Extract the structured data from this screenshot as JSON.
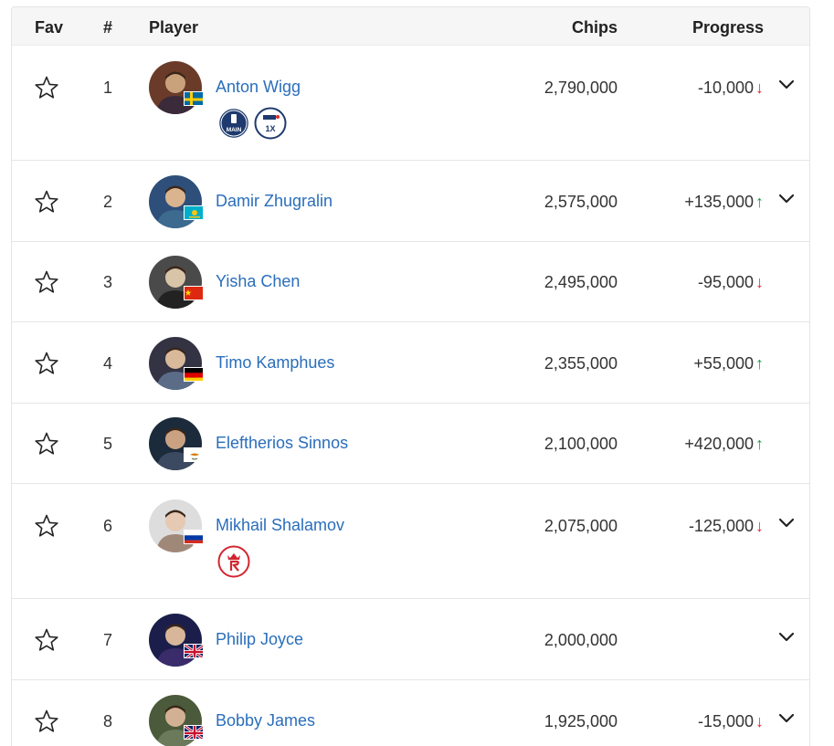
{
  "headers": {
    "fav": "Fav",
    "num": "#",
    "player": "Player",
    "chips": "Chips",
    "progress": "Progress"
  },
  "badge_text": {
    "main": "MAIN",
    "ept_count": "1X"
  },
  "colors": {
    "link": "#2a6ebb",
    "down": "#e02b2b",
    "up": "#1a9b3f",
    "header_bg": "#f6f6f6"
  },
  "rows": [
    {
      "rank": "1",
      "name": "Anton Wigg",
      "chips": "2,790,000",
      "progress": "-10,000",
      "dir": "down",
      "flag": "sweden-flag",
      "badges": [
        "main-event-badge",
        "ept-1x-badge"
      ],
      "expandable": true
    },
    {
      "rank": "2",
      "name": "Damir Zhugralin",
      "chips": "2,575,000",
      "progress": "+135,000",
      "dir": "up",
      "flag": "kazakhstan-flag",
      "badges": [],
      "expandable": true
    },
    {
      "rank": "3",
      "name": "Yisha Chen",
      "chips": "2,495,000",
      "progress": "-95,000",
      "dir": "down",
      "flag": "china-flag",
      "badges": [],
      "expandable": false
    },
    {
      "rank": "4",
      "name": "Timo Kamphues",
      "chips": "2,355,000",
      "progress": "+55,000",
      "dir": "up",
      "flag": "germany-flag",
      "badges": [],
      "expandable": false
    },
    {
      "rank": "5",
      "name": "Eleftherios Sinnos",
      "chips": "2,100,000",
      "progress": "+420,000",
      "dir": "up",
      "flag": "cyprus-flag",
      "badges": [],
      "expandable": false
    },
    {
      "rank": "6",
      "name": "Mikhail Shalamov",
      "chips": "2,075,000",
      "progress": "-125,000",
      "dir": "down",
      "flag": "russia-flag",
      "badges": [
        "crown-r-badge"
      ],
      "expandable": true
    },
    {
      "rank": "7",
      "name": "Philip Joyce",
      "chips": "2,000,000",
      "progress": "",
      "dir": "none",
      "flag": "uk-flag",
      "badges": [],
      "expandable": true
    },
    {
      "rank": "8",
      "name": "Bobby James",
      "chips": "1,925,000",
      "progress": "-15,000",
      "dir": "down",
      "flag": "uk-flag",
      "badges": [],
      "expandable": true
    }
  ]
}
